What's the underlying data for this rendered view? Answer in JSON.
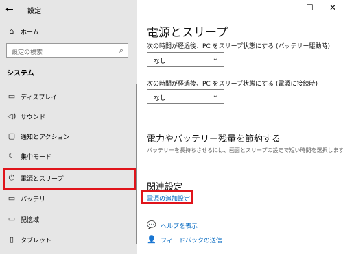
{
  "window": {
    "title": "設定",
    "back_icon": "arrow-left-icon",
    "minimize": "—",
    "maximize": "☐",
    "close": "✕"
  },
  "sidebar": {
    "home_label": "ホーム",
    "search_placeholder": "設定の検索",
    "section_title": "システム",
    "items": [
      {
        "label": "ディスプレイ",
        "icon": "display-icon",
        "glyph": "▭"
      },
      {
        "label": "サウンド",
        "icon": "sound-icon",
        "glyph": "◁)"
      },
      {
        "label": "通知とアクション",
        "icon": "notification-icon",
        "glyph": "▢"
      },
      {
        "label": "集中モード",
        "icon": "focus-moon-icon",
        "glyph": "☾"
      },
      {
        "label": "電源とスリープ",
        "icon": "power-icon",
        "glyph": "⏻"
      },
      {
        "label": "バッテリー",
        "icon": "battery-icon",
        "glyph": "▭"
      },
      {
        "label": "記憶域",
        "icon": "storage-icon",
        "glyph": "▭"
      },
      {
        "label": "タブレット",
        "icon": "tablet-icon",
        "glyph": "▯"
      }
    ],
    "selected_index": 4
  },
  "main": {
    "title": "電源とスリープ",
    "sleep_battery_label": "次の時間が経過後、PC をスリープ状態にする (バッテリー駆動時)",
    "sleep_battery_value": "なし",
    "sleep_ac_label": "次の時間が経過後、PC をスリープ状態にする (電源に接続時)",
    "sleep_ac_value": "なし",
    "save_title": "電力やバッテリー残量を節約する",
    "save_desc": "バッテリーを長持ちさせるには、画面とスリープの設定で短い時間を選択します。",
    "related_title": "関連設定",
    "related_link": "電源の追加設定",
    "help_label": "ヘルプを表示",
    "feedback_label": "フィードバックの送信"
  },
  "colors": {
    "highlight_box": "#e0141b",
    "link": "#0067c0",
    "sidebar_bg": "#e6e6e6"
  }
}
